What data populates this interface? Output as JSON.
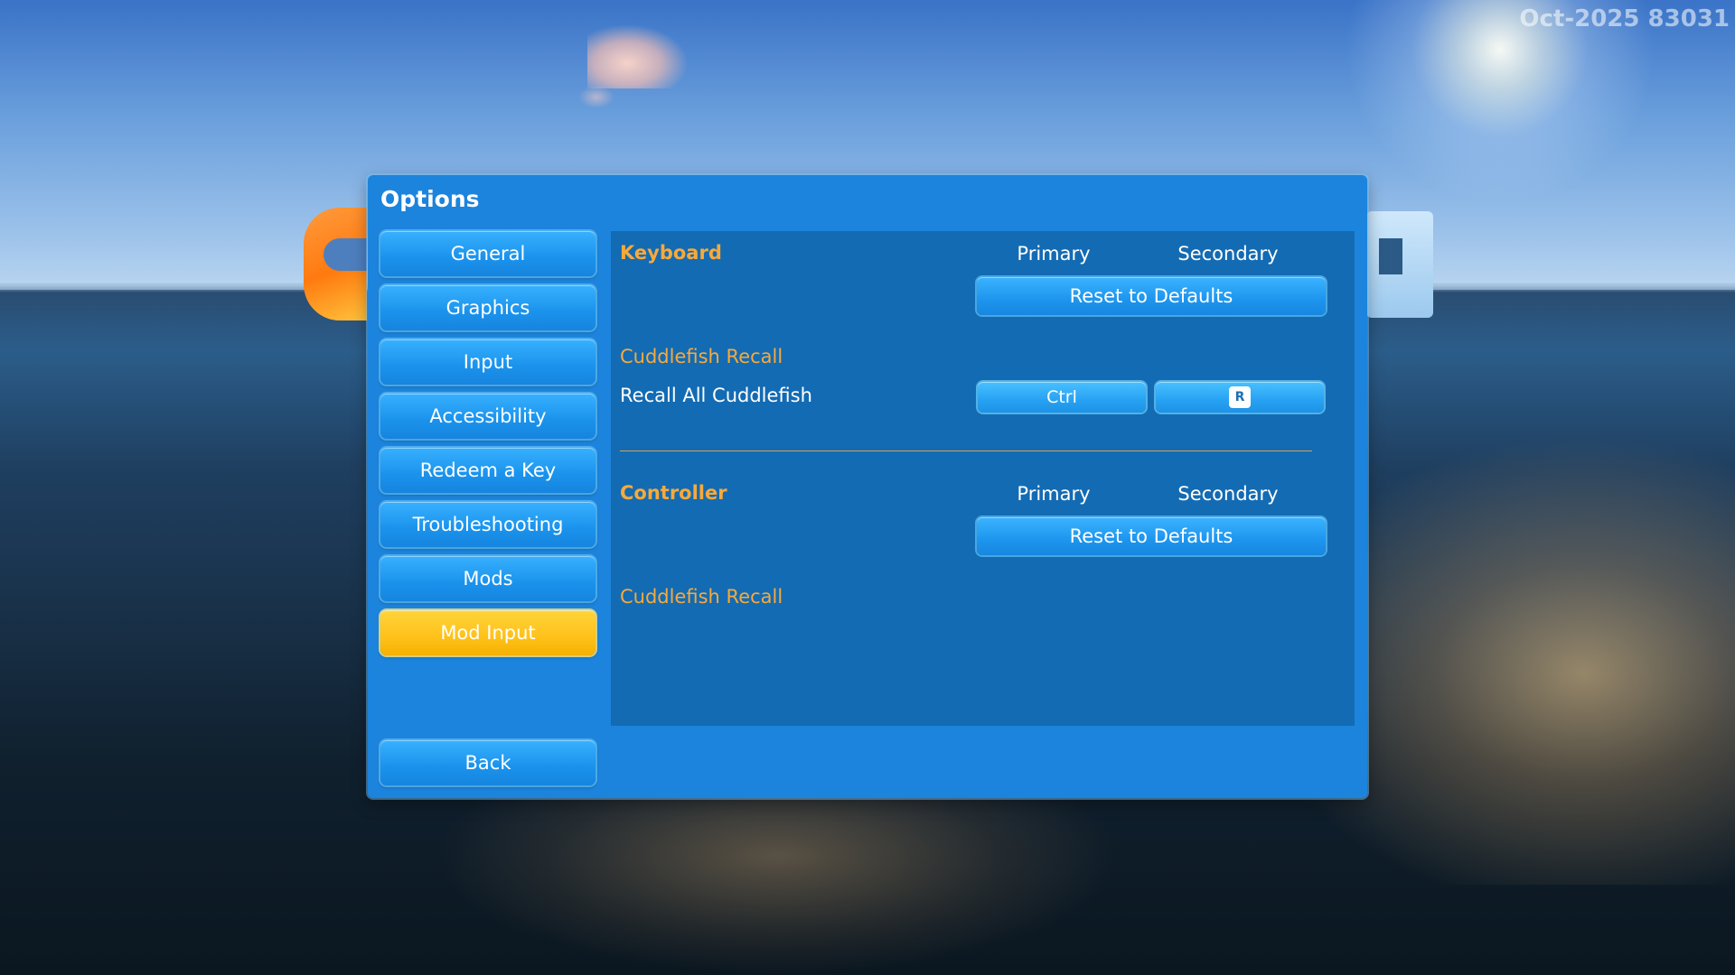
{
  "scene": {
    "watermark": "Oct-2025 83031"
  },
  "window": {
    "title": "Options"
  },
  "nav": {
    "items": [
      {
        "label": "General"
      },
      {
        "label": "Graphics"
      },
      {
        "label": "Input"
      },
      {
        "label": "Accessibility"
      },
      {
        "label": "Redeem a Key"
      },
      {
        "label": "Troubleshooting"
      },
      {
        "label": "Mods"
      },
      {
        "label": "Mod Input",
        "active": true
      }
    ],
    "back_label": "Back"
  },
  "keyboard": {
    "title": "Keyboard",
    "primary_label": "Primary",
    "secondary_label": "Secondary",
    "reset_label": "Reset to Defaults",
    "group": "Cuddlefish Recall",
    "binding": {
      "label": "Recall All Cuddlefish",
      "primary": "Ctrl",
      "secondary_key": "R"
    }
  },
  "controller": {
    "title": "Controller",
    "primary_label": "Primary",
    "secondary_label": "Secondary",
    "reset_label": "Reset to Defaults",
    "group": "Cuddlefish Recall"
  },
  "colors": {
    "accent_orange": "#f7a93b",
    "panel_blue": "#1c84dc",
    "content_blue": "#136bb3",
    "active_yellow": "#ffc11a"
  }
}
